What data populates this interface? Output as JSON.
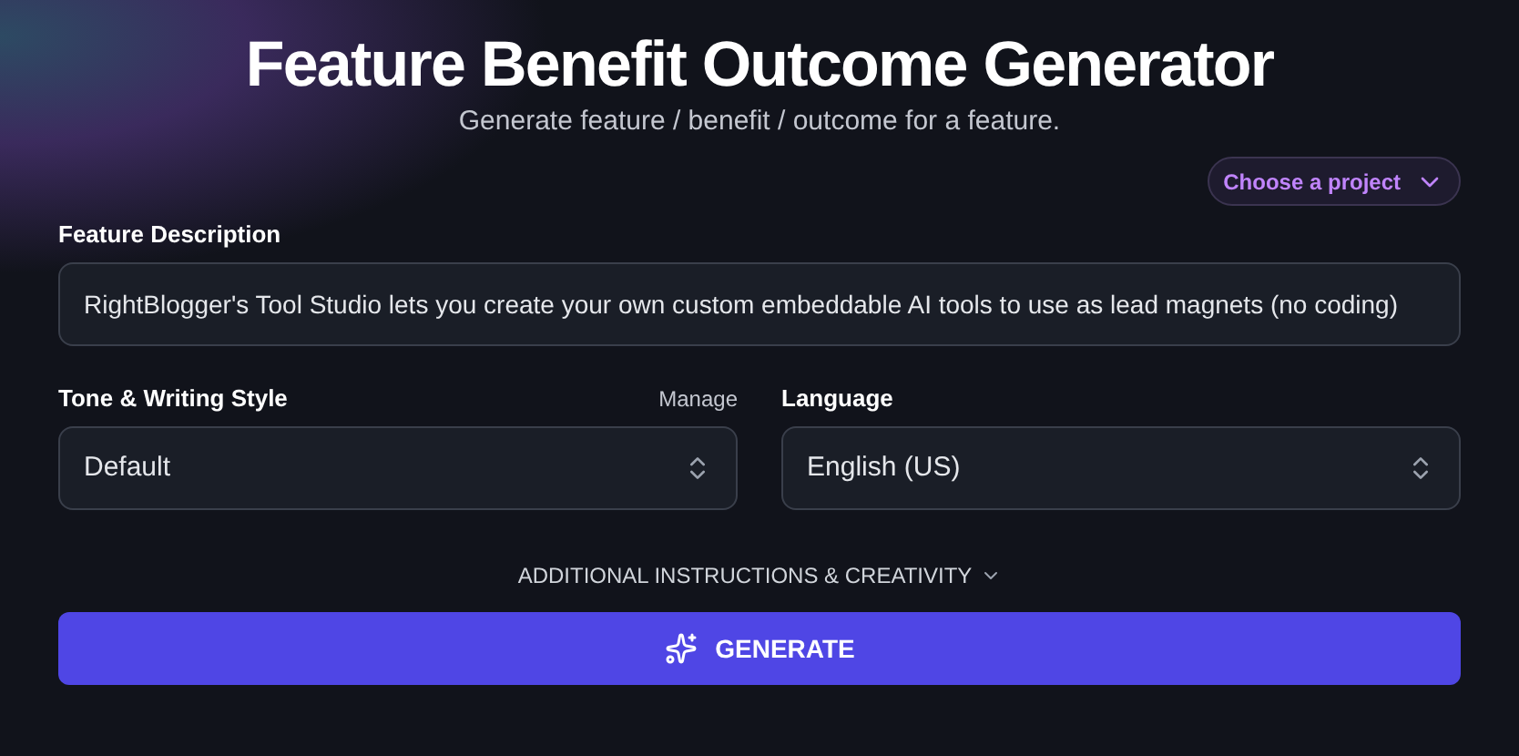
{
  "header": {
    "title": "Feature Benefit Outcome Generator",
    "subtitle": "Generate feature / benefit / outcome for a feature."
  },
  "project_picker": {
    "label": "Choose a project"
  },
  "feature_description": {
    "label": "Feature Description",
    "value": "RightBlogger's Tool Studio lets you create your own custom embeddable AI tools to use as lead magnets (no coding)"
  },
  "tone": {
    "label": "Tone & Writing Style",
    "manage_link": "Manage",
    "value": "Default"
  },
  "language": {
    "label": "Language",
    "value": "English (US)"
  },
  "additional": {
    "label": "ADDITIONAL INSTRUCTIONS & CREATIVITY",
    "expanded": false
  },
  "generate_button": {
    "label": "GENERATE"
  }
}
